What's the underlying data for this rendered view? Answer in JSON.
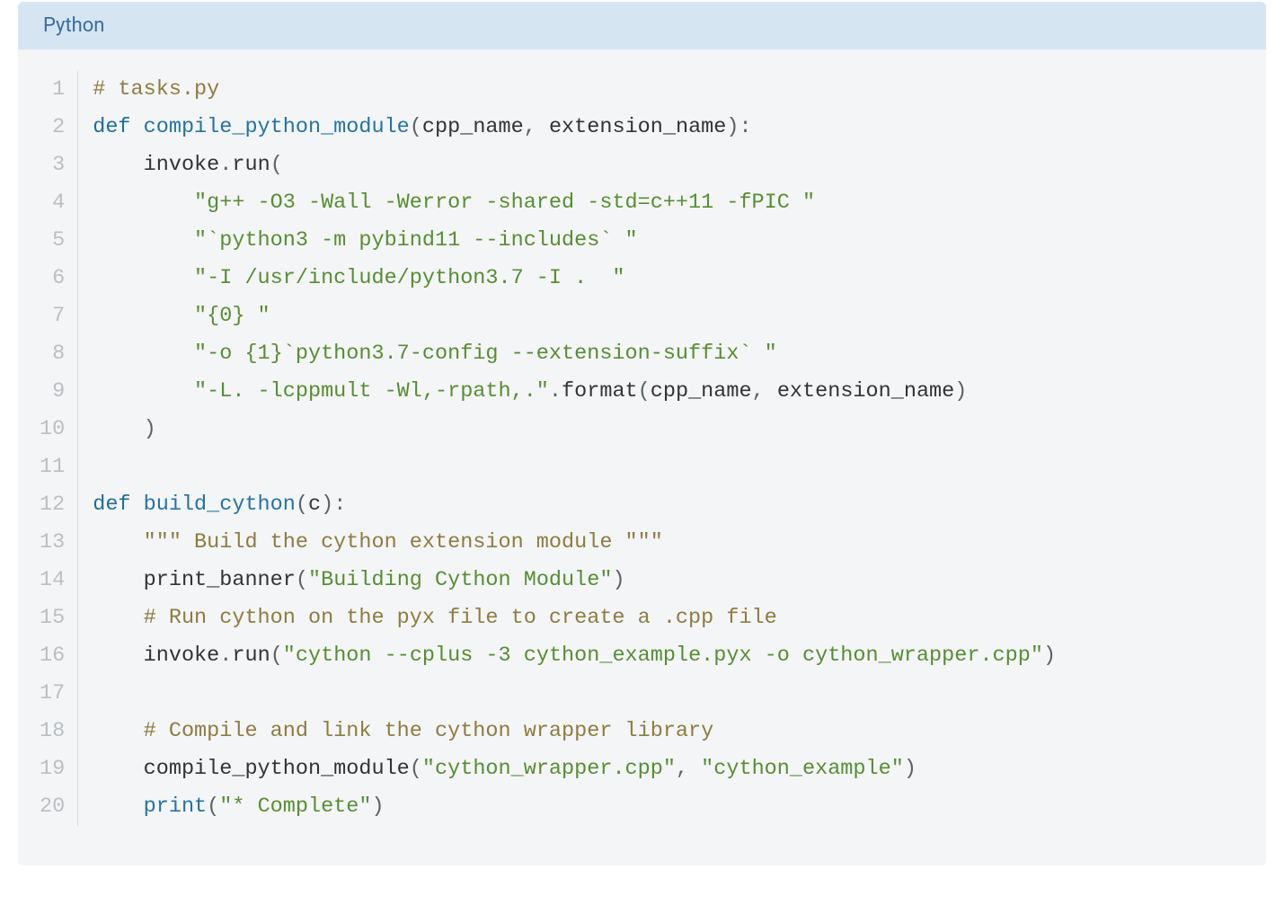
{
  "header": {
    "language": "Python"
  },
  "code": {
    "line_count": 20,
    "lines": [
      {
        "indent": 0,
        "tokens": [
          {
            "t": "# tasks.py",
            "c": "comment"
          }
        ]
      },
      {
        "indent": 0,
        "tokens": [
          {
            "t": "def",
            "c": "kw"
          },
          {
            "t": " "
          },
          {
            "t": "compile_python_module",
            "c": "fn"
          },
          {
            "t": "(",
            "c": "punct"
          },
          {
            "t": "cpp_name",
            "c": "name"
          },
          {
            "t": ",",
            "c": "punct"
          },
          {
            "t": " "
          },
          {
            "t": "extension_name",
            "c": "name"
          },
          {
            "t": "):",
            "c": "punct"
          }
        ]
      },
      {
        "indent": 1,
        "tokens": [
          {
            "t": "invoke",
            "c": "name"
          },
          {
            "t": ".",
            "c": "op"
          },
          {
            "t": "run",
            "c": "name"
          },
          {
            "t": "(",
            "c": "punct"
          }
        ]
      },
      {
        "indent": 2,
        "tokens": [
          {
            "t": "\"g++ -O3 -Wall -Werror -shared -std=c++11 -fPIC \"",
            "c": "str"
          }
        ]
      },
      {
        "indent": 2,
        "tokens": [
          {
            "t": "\"`python3 -m pybind11 --includes` \"",
            "c": "str"
          }
        ]
      },
      {
        "indent": 2,
        "tokens": [
          {
            "t": "\"-I /usr/include/python3.7 -I .  \"",
            "c": "str"
          }
        ]
      },
      {
        "indent": 2,
        "tokens": [
          {
            "t": "\"{0} \"",
            "c": "str"
          }
        ]
      },
      {
        "indent": 2,
        "tokens": [
          {
            "t": "\"-o {1}`python3.7-config --extension-suffix` \"",
            "c": "str"
          }
        ]
      },
      {
        "indent": 2,
        "tokens": [
          {
            "t": "\"-L. -lcppmult -Wl,-rpath,.\"",
            "c": "str"
          },
          {
            "t": ".",
            "c": "op"
          },
          {
            "t": "format",
            "c": "name"
          },
          {
            "t": "(",
            "c": "punct"
          },
          {
            "t": "cpp_name",
            "c": "name"
          },
          {
            "t": ",",
            "c": "punct"
          },
          {
            "t": " "
          },
          {
            "t": "extension_name",
            "c": "name"
          },
          {
            "t": ")",
            "c": "punct"
          }
        ]
      },
      {
        "indent": 1,
        "tokens": [
          {
            "t": ")",
            "c": "punct"
          }
        ]
      },
      {
        "indent": 0,
        "tokens": []
      },
      {
        "indent": 0,
        "tokens": [
          {
            "t": "def",
            "c": "kw"
          },
          {
            "t": " "
          },
          {
            "t": "build_cython",
            "c": "fn"
          },
          {
            "t": "(",
            "c": "punct"
          },
          {
            "t": "c",
            "c": "name"
          },
          {
            "t": "):",
            "c": "punct"
          }
        ]
      },
      {
        "indent": 1,
        "tokens": [
          {
            "t": "\"\"\" Build the cython extension module \"\"\"",
            "c": "docstr"
          }
        ]
      },
      {
        "indent": 1,
        "tokens": [
          {
            "t": "print_banner",
            "c": "name"
          },
          {
            "t": "(",
            "c": "punct"
          },
          {
            "t": "\"Building Cython Module\"",
            "c": "str"
          },
          {
            "t": ")",
            "c": "punct"
          }
        ]
      },
      {
        "indent": 1,
        "tokens": [
          {
            "t": "# Run cython on the pyx file to create a .cpp file",
            "c": "comment"
          }
        ]
      },
      {
        "indent": 1,
        "tokens": [
          {
            "t": "invoke",
            "c": "name"
          },
          {
            "t": ".",
            "c": "op"
          },
          {
            "t": "run",
            "c": "name"
          },
          {
            "t": "(",
            "c": "punct"
          },
          {
            "t": "\"cython --cplus -3 cython_example.pyx -o cython_wrapper.cpp\"",
            "c": "str"
          },
          {
            "t": ")",
            "c": "punct"
          }
        ]
      },
      {
        "indent": 0,
        "tokens": []
      },
      {
        "indent": 1,
        "tokens": [
          {
            "t": "# Compile and link the cython wrapper library",
            "c": "comment"
          }
        ]
      },
      {
        "indent": 1,
        "tokens": [
          {
            "t": "compile_python_module",
            "c": "name"
          },
          {
            "t": "(",
            "c": "punct"
          },
          {
            "t": "\"cython_wrapper.cpp\"",
            "c": "str"
          },
          {
            "t": ",",
            "c": "punct"
          },
          {
            "t": " "
          },
          {
            "t": "\"cython_example\"",
            "c": "str"
          },
          {
            "t": ")",
            "c": "punct"
          }
        ]
      },
      {
        "indent": 1,
        "tokens": [
          {
            "t": "print",
            "c": "fn"
          },
          {
            "t": "(",
            "c": "punct"
          },
          {
            "t": "\"* Complete\"",
            "c": "str"
          },
          {
            "t": ")",
            "c": "punct"
          }
        ]
      }
    ]
  }
}
